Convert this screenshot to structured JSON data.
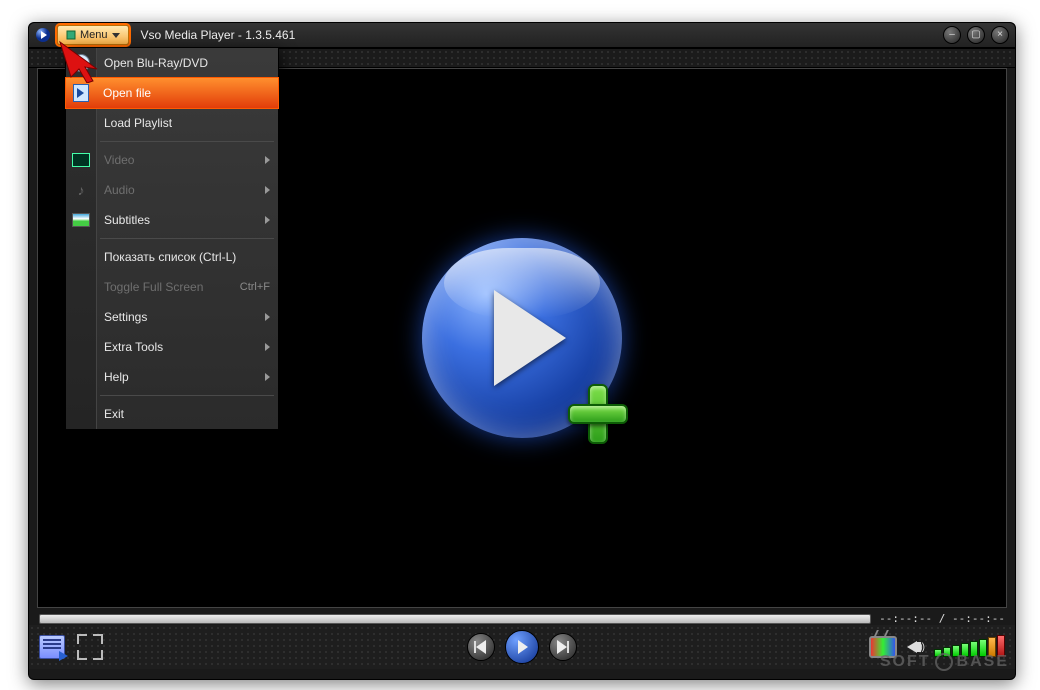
{
  "titlebar": {
    "menu_label": "Menu",
    "title": "Vso Media Player - 1.3.5.461"
  },
  "menu": {
    "items": [
      {
        "label": "Open Blu-Ray/DVD",
        "icon": "disc-icon",
        "enabled": true
      },
      {
        "label": "Open file",
        "icon": "file-icon",
        "enabled": true,
        "selected": true
      },
      {
        "label": "Load Playlist",
        "enabled": true
      },
      {
        "sep": true
      },
      {
        "label": "Video",
        "icon": "video-icon",
        "enabled": false,
        "submenu": true
      },
      {
        "label": "Audio",
        "icon": "audio-icon",
        "enabled": false,
        "submenu": true
      },
      {
        "label": "Subtitles",
        "icon": "subtitles-icon",
        "enabled": true,
        "submenu": true
      },
      {
        "sep": true
      },
      {
        "label": "Показать список (Ctrl-L)",
        "enabled": true
      },
      {
        "label": "Toggle Full Screen",
        "enabled": false,
        "shortcut": "Ctrl+F"
      },
      {
        "label": "Settings",
        "enabled": true,
        "submenu": true
      },
      {
        "label": "Extra Tools",
        "enabled": true,
        "submenu": true
      },
      {
        "label": "Help",
        "enabled": true,
        "submenu": true
      },
      {
        "sep": true
      },
      {
        "label": "Exit",
        "enabled": true
      }
    ]
  },
  "status": {
    "time": "--:--:-- / --:--:--"
  },
  "watermark": {
    "left": "SOFT",
    "right": "BASE"
  }
}
